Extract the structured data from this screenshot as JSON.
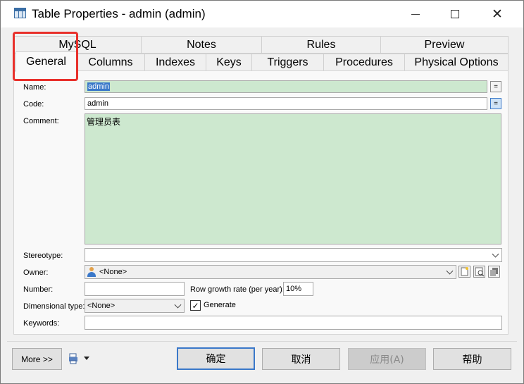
{
  "window": {
    "title": "Table Properties - admin (admin)"
  },
  "tabs": {
    "row_back": [
      "MySQL",
      "Notes",
      "Rules",
      "Preview"
    ],
    "row_front": [
      "General",
      "Columns",
      "Indexes",
      "Keys",
      "Triggers",
      "Procedures",
      "Physical Options"
    ],
    "active": "General"
  },
  "form": {
    "name_label": "Name:",
    "name_value": "admin",
    "code_label": "Code:",
    "code_value": "admin",
    "comment_label": "Comment:",
    "comment_value": "管理员表",
    "stereotype_label": "Stereotype:",
    "stereotype_value": "",
    "owner_label": "Owner:",
    "owner_value": "<None>",
    "number_label": "Number:",
    "number_value": "",
    "row_growth_label": "Row growth rate (per year):",
    "row_growth_value": "10%",
    "dimensional_label": "Dimensional type:",
    "dimensional_value": "<None>",
    "generate_label": "Generate",
    "generate_checked": true,
    "keywords_label": "Keywords:",
    "keywords_value": "",
    "eq_symbol": "="
  },
  "footer": {
    "more": "More >>",
    "ok": "确定",
    "cancel": "取消",
    "apply": "应用(A)",
    "help": "帮助"
  },
  "colors": {
    "field_green": "#cde8cf",
    "highlight": "#e8302b",
    "accent": "#3a78c9"
  },
  "icons": [
    "table-icon",
    "minimize-icon",
    "maximize-icon",
    "close-icon",
    "user-icon",
    "chevron-down-icon",
    "properties-icon",
    "print-icon"
  ]
}
